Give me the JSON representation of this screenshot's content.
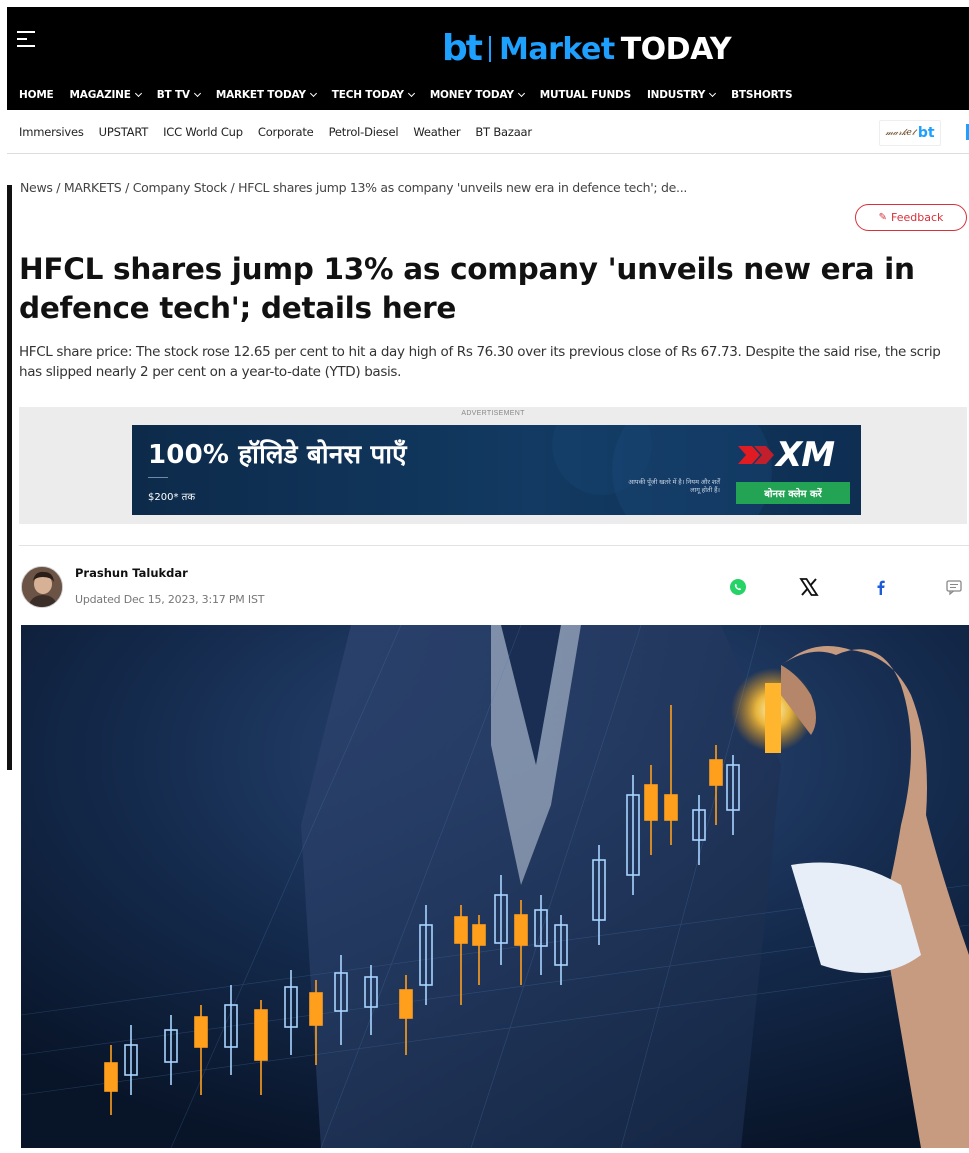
{
  "header": {
    "logo_bt": "bt",
    "logo_market": "Market",
    "logo_today": "TODAY",
    "nav": [
      {
        "label": "HOME",
        "dropdown": false
      },
      {
        "label": "MAGAZINE",
        "dropdown": true
      },
      {
        "label": "BT TV",
        "dropdown": true
      },
      {
        "label": "MARKET TODAY",
        "dropdown": true
      },
      {
        "label": "TECH TODAY",
        "dropdown": true
      },
      {
        "label": "MONEY TODAY",
        "dropdown": true
      },
      {
        "label": "MUTUAL FUNDS",
        "dropdown": false
      },
      {
        "label": "INDUSTRY",
        "dropdown": true
      },
      {
        "label": "BTSHORTS",
        "dropdown": false
      }
    ],
    "subnav": [
      "Immersives",
      "UPSTART",
      "ICC World Cup",
      "Corporate",
      "Petrol-Diesel",
      "Weather",
      "BT Bazaar"
    ],
    "promo_bt": "bt"
  },
  "breadcrumb": {
    "items": [
      "News",
      "MARKETS",
      "Company Stock",
      "HFCL shares jump 13% as company 'unveils new era in defence tech'; de..."
    ],
    "separator": " / "
  },
  "feedback": {
    "label": "Feedback"
  },
  "article": {
    "headline": "HFCL shares jump 13% as company 'unveils new era in defence tech'; details here",
    "summary": "HFCL share price: The stock rose 12.65 per cent to hit a day high of Rs 76.30 over its previous close of Rs 67.73. Despite the said rise, the scrip has slipped nearly 2 per cent on a year-to-date (YTD) basis.",
    "author": "Prashun Talukdar",
    "updated": "Updated Dec 15, 2023, 3:17 PM IST"
  },
  "advertisement": {
    "label": "ADVERTISEMENT",
    "headline": "100% हॉलिडे बोनस पाएँ",
    "sub": "$200* तक",
    "fine_print": "आपकी पूँजी खतरे में है। नियम और शर्तें लागू होती हैं।",
    "brand": "XM",
    "cta": "बोनस क्लेम करें"
  },
  "share": {
    "icons": [
      "whatsapp-icon",
      "x-icon",
      "facebook-icon",
      "comment-icon"
    ]
  },
  "colors": {
    "brand_blue": "#1ea0ff",
    "feedback_red": "#d9303a",
    "cta_green": "#23a455"
  }
}
